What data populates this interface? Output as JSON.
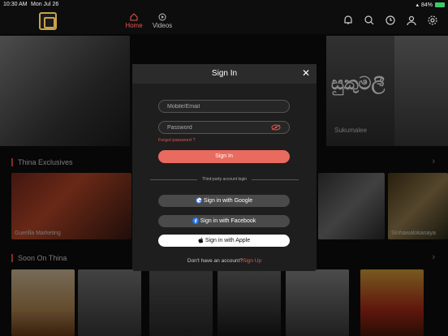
{
  "status_bar": {
    "time": "10:30 AM",
    "date": "Mon Jul 26",
    "battery": "84%"
  },
  "nav": {
    "home_label": "Home",
    "videos_label": "Videos"
  },
  "background": {
    "banner_title": "Sukumalee",
    "banner_sinhala": "සුකුමලී",
    "section1_title": "Thina Exclusives",
    "section2_title": "Soon On Thina",
    "tile1_caption": "Guerilla Marketing",
    "tile2_caption": "Sinhawalokanaya"
  },
  "modal": {
    "title": "Sign In",
    "email_placeholder": "Mobile/Email",
    "password_placeholder": "Password",
    "forgot_label": "Forgot password ?",
    "signin_label": "Sign In",
    "third_party_label": "Third-party account login",
    "google_label": "Sign in with Google",
    "facebook_label": "Sign in with Facebook",
    "apple_label": "Sign in with Apple",
    "no_account_text": "Don't have an account?",
    "signup_label": "Sign Up"
  },
  "colors": {
    "accent": "#e7564a",
    "modal_bg": "#1e1e1e"
  }
}
